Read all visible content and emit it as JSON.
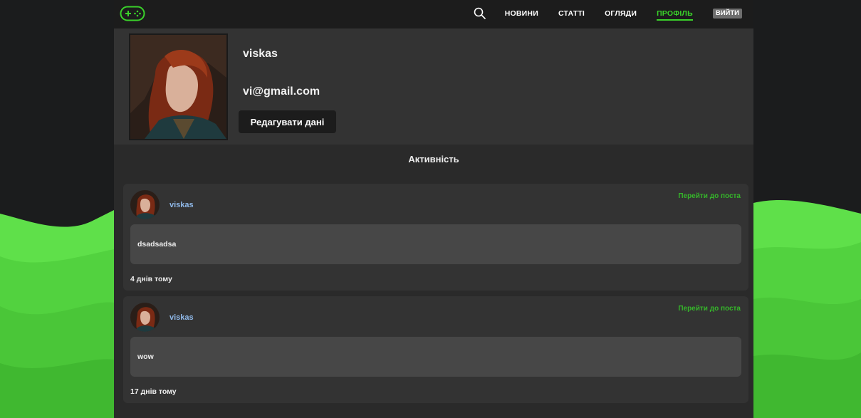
{
  "nav": {
    "links": [
      "НОВИНИ",
      "СТАТТІ",
      "ОГЛЯДИ",
      "ПРОФІЛЬ"
    ],
    "active": "ПРОФІЛЬ",
    "logout_label": "ВИЙТИ"
  },
  "profile": {
    "username": "viskas",
    "email": "vi@gmail.com",
    "edit_label": "Редагувати дані"
  },
  "activity": {
    "title": "Активність",
    "posts": [
      {
        "author": "viskas",
        "goto_label": "Перейти до поста",
        "text": "dsadsadsa",
        "time": "4 днів тому"
      },
      {
        "author": "viskas",
        "goto_label": "Перейти до поста",
        "text": "wow",
        "time": "17 днів тому"
      }
    ]
  },
  "colors": {
    "accent": "#3ad22a",
    "background": "#1b1c1d",
    "panel": "#2a2a2a",
    "card": "#333333"
  },
  "icons": [
    "gamepad-logo-icon",
    "search-icon"
  ]
}
